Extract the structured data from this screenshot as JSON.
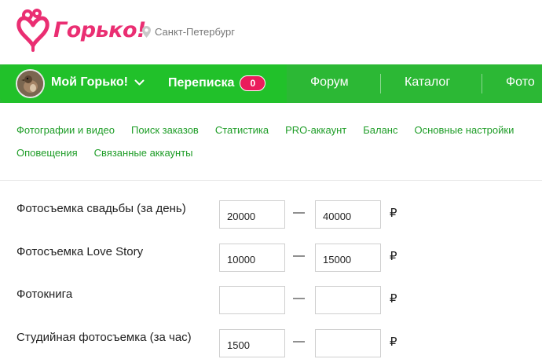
{
  "brand": {
    "name": "Горько!",
    "color": "#ea2e72"
  },
  "city": {
    "label": "Санкт-Петербург",
    "icon": "location-pin-icon"
  },
  "navbar": {
    "background": "#2cb835",
    "my_gorko_label": "Мой Горько!",
    "messages_label": "Переписка",
    "messages_count": "0",
    "items": [
      {
        "label": "Форум"
      },
      {
        "label": "Каталог"
      },
      {
        "label": "Фото"
      }
    ]
  },
  "submenu": {
    "row1": [
      {
        "label": "Фотографии и видео"
      },
      {
        "label": "Поиск заказов"
      },
      {
        "label": "Статистика"
      },
      {
        "label": "PRO-аккаунт"
      },
      {
        "label": "Баланс"
      },
      {
        "label": "Основные настройки"
      }
    ],
    "row2": [
      {
        "label": "Оповещения"
      },
      {
        "label": "Связанные аккаунты"
      }
    ]
  },
  "prices": {
    "dash": "—",
    "currency": "₽",
    "rows": [
      {
        "label": "Фотосъемка свадьбы (за день)",
        "from": "20000",
        "to": "40000"
      },
      {
        "label": "Фотосъемка Love Story",
        "from": "10000",
        "to": "15000"
      },
      {
        "label": "Фотокнига",
        "from": "",
        "to": ""
      },
      {
        "label": "Студийная фотосъемка (за час)",
        "from": "1500",
        "to": ""
      }
    ]
  }
}
